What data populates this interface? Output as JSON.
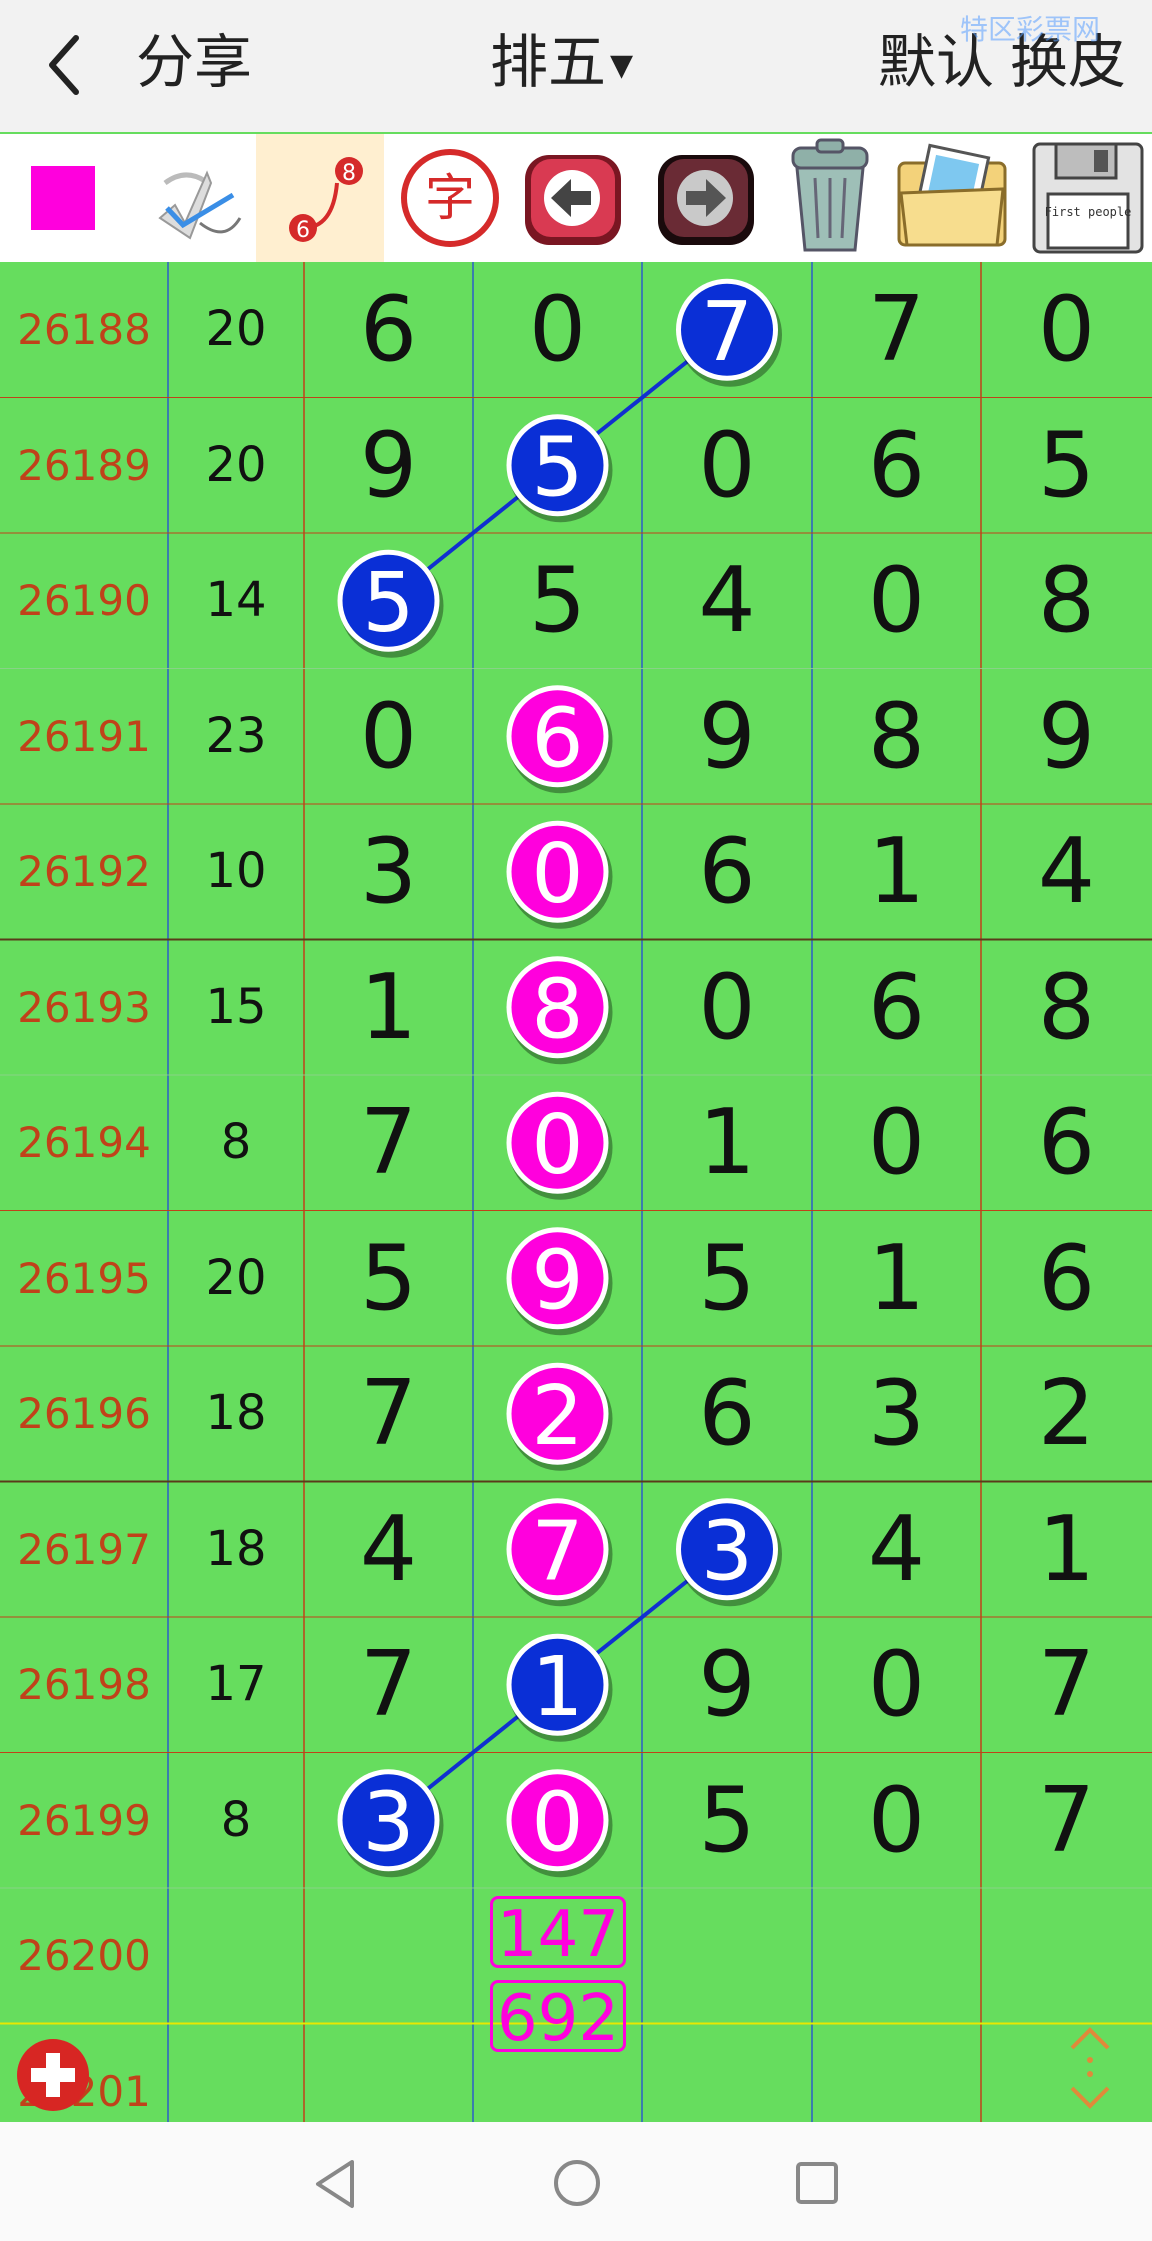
{
  "header": {
    "share": "分享",
    "title": "排五",
    "default": "默认",
    "skin": "换皮",
    "watermark": "特区彩票网"
  },
  "toolbar": {
    "colors": {
      "swatch": "#FF00DD",
      "active_bg": "#FFEFD0"
    },
    "items": [
      "color-swatch",
      "pen-tool",
      "line-tool",
      "text-tool",
      "undo",
      "redo",
      "delete",
      "image",
      "save"
    ],
    "line_icon_numbers": [
      "8",
      "6"
    ],
    "text_icon_char": "字",
    "save_icon_text": "First people"
  },
  "colors": {
    "grid_bg": "#66DD5E",
    "period_text": "#C0421A",
    "blue_ball": "#0A2FD6",
    "magenta_ball": "#FF00DD"
  },
  "rows": [
    {
      "period": "26188",
      "sum": "20",
      "digits": [
        "6",
        "0",
        "7",
        "7",
        "0"
      ]
    },
    {
      "period": "26189",
      "sum": "20",
      "digits": [
        "9",
        "5",
        "0",
        "6",
        "5"
      ]
    },
    {
      "period": "26190",
      "sum": "14",
      "digits": [
        "5",
        "5",
        "4",
        "0",
        "8"
      ]
    },
    {
      "period": "26191",
      "sum": "23",
      "digits": [
        "0",
        "6",
        "9",
        "8",
        "9"
      ]
    },
    {
      "period": "26192",
      "sum": "10",
      "digits": [
        "3",
        "0",
        "6",
        "1",
        "4"
      ]
    },
    {
      "period": "26193",
      "sum": "15",
      "digits": [
        "1",
        "8",
        "0",
        "6",
        "8"
      ]
    },
    {
      "period": "26194",
      "sum": "8",
      "digits": [
        "7",
        "0",
        "1",
        "0",
        "6"
      ]
    },
    {
      "period": "26195",
      "sum": "20",
      "digits": [
        "5",
        "9",
        "5",
        "1",
        "6"
      ]
    },
    {
      "period": "26196",
      "sum": "18",
      "digits": [
        "7",
        "2",
        "6",
        "3",
        "2"
      ]
    },
    {
      "period": "26197",
      "sum": "18",
      "digits": [
        "4",
        "7",
        "3",
        "4",
        "1"
      ]
    },
    {
      "period": "26198",
      "sum": "17",
      "digits": [
        "7",
        "1",
        "9",
        "0",
        "7"
      ]
    },
    {
      "period": "26199",
      "sum": "8",
      "digits": [
        "3",
        "0",
        "5",
        "0",
        "7"
      ]
    }
  ],
  "pending_rows": [
    "26200",
    "26201"
  ],
  "prediction": [
    "147",
    "692"
  ]
}
